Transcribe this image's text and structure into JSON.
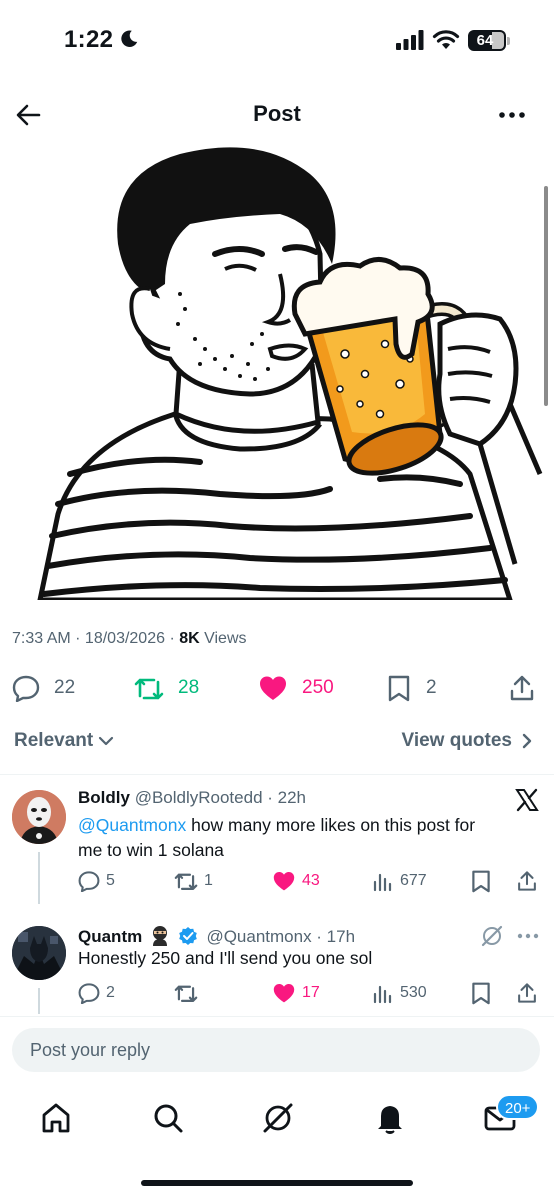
{
  "status_bar": {
    "time": "1:22",
    "battery": "64",
    "battery_level": 0.64
  },
  "header": {
    "title": "Post"
  },
  "post": {
    "timestamp": "7:33 AM · 18/03/2026 · ",
    "views_count": "8K",
    "views_label": " Views",
    "stats": {
      "replies": "22",
      "reposts": "28",
      "likes": "250",
      "bookmarks": "2"
    },
    "colors": {
      "repost": "#00ba7c",
      "like": "#f91880",
      "muted": "#536471",
      "link": "#1d9bf0"
    }
  },
  "sort": {
    "relevant_label": "Relevant",
    "view_quotes_label": "View quotes"
  },
  "replies": [
    {
      "name": "Boldly",
      "handle": "@BoldlyRootedd",
      "time": " · 22h",
      "mention": "@Quantmonx",
      "text": " how many more likes on this post for me to win 1 solana",
      "replies": "5",
      "reposts": "1",
      "likes": "43",
      "views": "677"
    },
    {
      "name": "Quantm",
      "handle": "@Quantmonx",
      "time": " · 17h",
      "text": "Honestly 250 and I'll send you one sol",
      "replies": "2",
      "reposts": "",
      "likes": "17",
      "views": "530"
    }
  ],
  "reply_box": {
    "placeholder": "Post your reply"
  },
  "bottom_nav": {
    "items": [
      "home-icon",
      "search-icon",
      "grok-icon",
      "notifications-icon",
      "messages-icon"
    ],
    "messages_badge": "20+"
  }
}
